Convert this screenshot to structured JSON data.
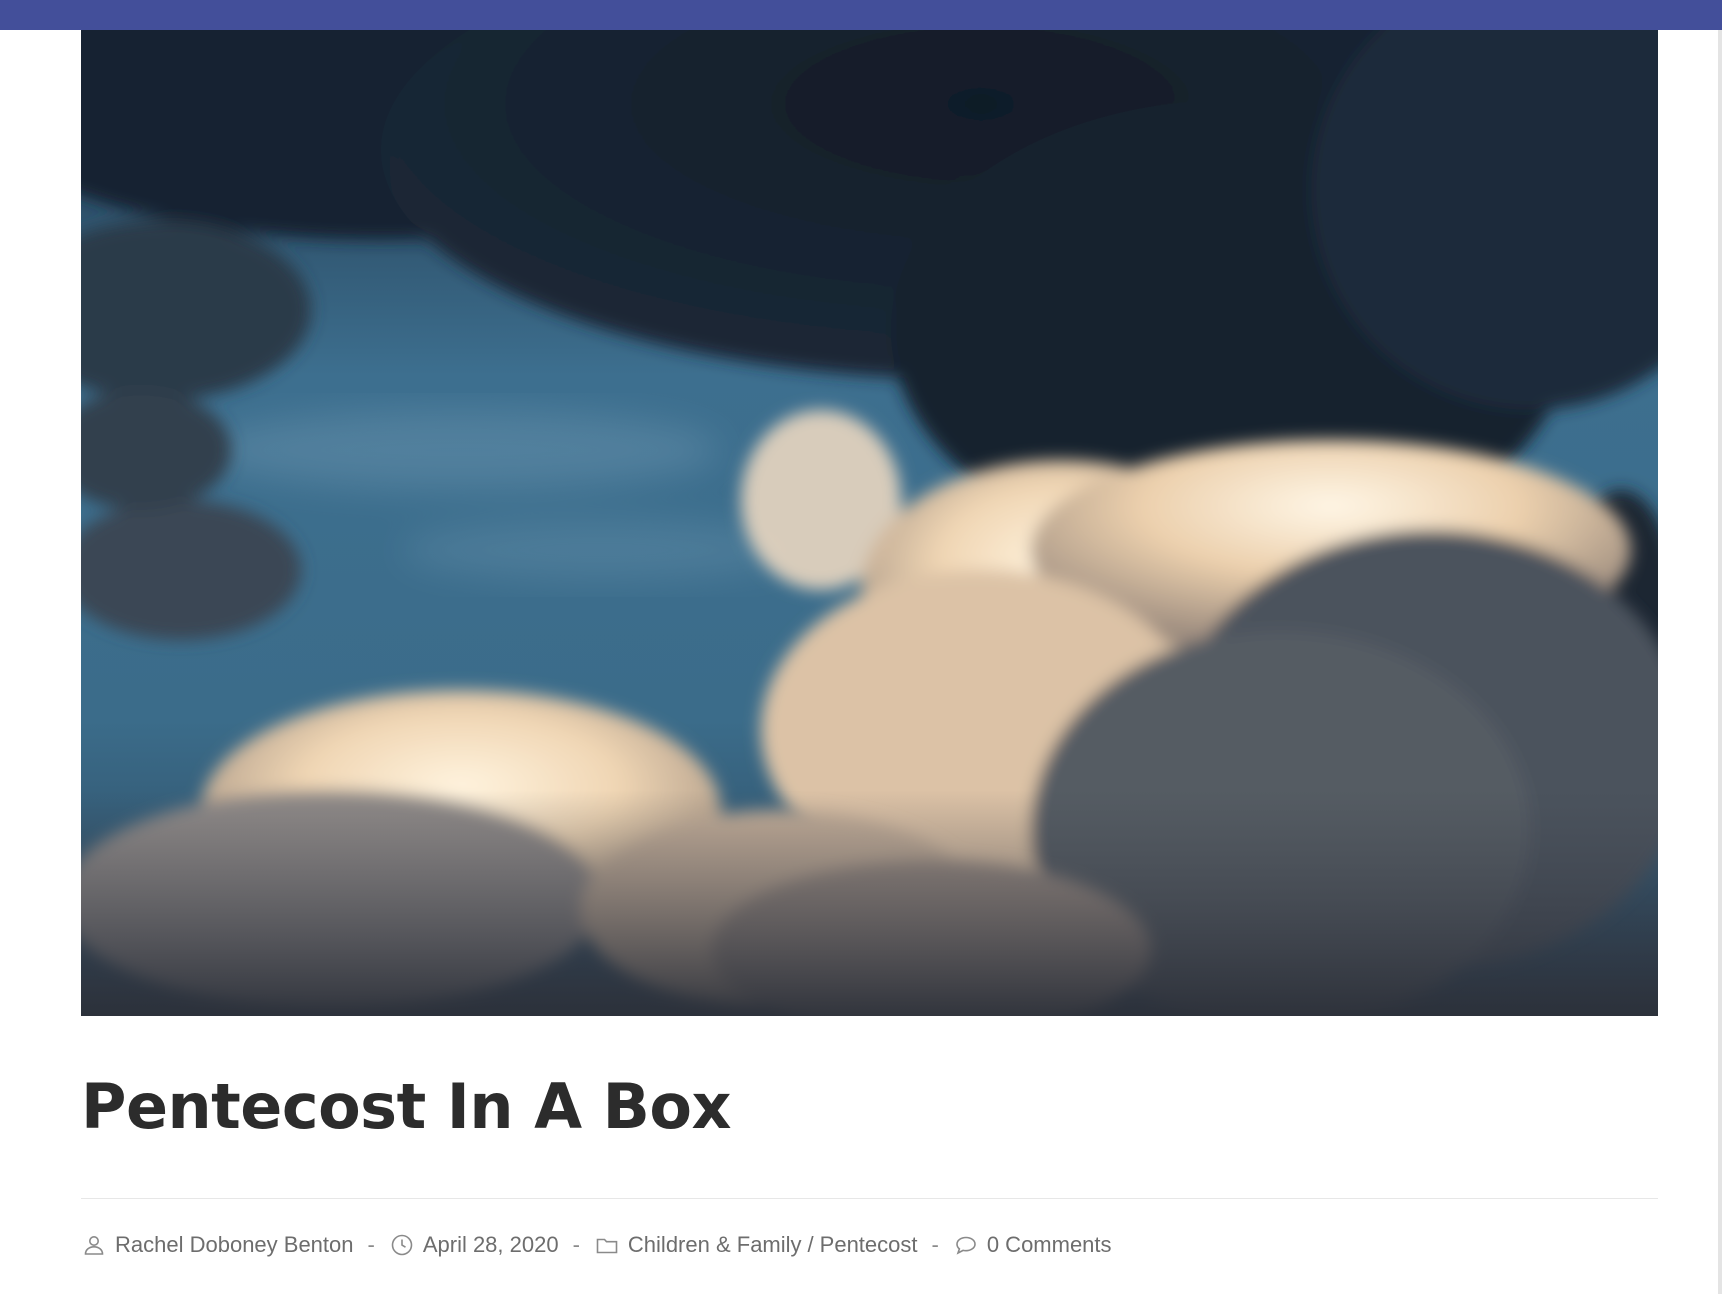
{
  "colors": {
    "topbar": "#434f9a",
    "title": "#2c2c2c",
    "meta_text": "#6d6d6d",
    "divider": "#e7e7e7"
  },
  "hero": {
    "alt_icon": "cloudy-sky-photo"
  },
  "post": {
    "title": "Pentecost In A Box"
  },
  "meta": {
    "author": "Rachel Doboney Benton",
    "date": "April 28, 2020",
    "category_1": "Children & Family",
    "category_separator": "/",
    "category_2": "Pentecost",
    "comments": "0 Comments",
    "separator": "-",
    "icons": {
      "author": "user-icon",
      "date": "clock-icon",
      "category": "folder-icon",
      "comments": "comment-bubble-icon"
    }
  }
}
